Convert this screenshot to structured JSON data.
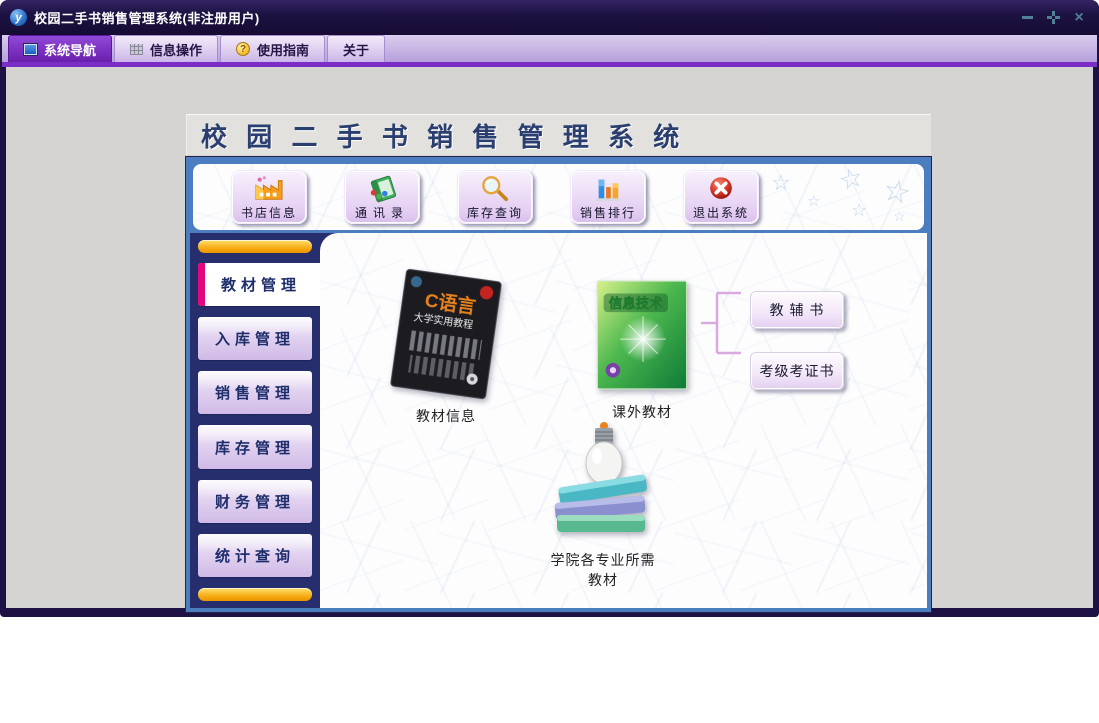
{
  "window": {
    "title": "校园二手书销售管理系统(非注册用户)",
    "app_icon_letter": "y",
    "controls": {
      "close_glyph": "×"
    }
  },
  "tabs": [
    {
      "label": "系统导航",
      "icon": "monitor-square-icon",
      "active": true
    },
    {
      "label": "信息操作",
      "icon": "grid-icon",
      "active": false
    },
    {
      "label": "使用指南",
      "icon": "help-coin-icon",
      "active": false,
      "icon_glyph": "?"
    },
    {
      "label": "关于",
      "active": false
    }
  ],
  "banner": {
    "title": "校 园 二 手 书 销 售 管 理 系 统"
  },
  "toolbar": {
    "buttons": [
      {
        "label": "书店信息",
        "icon": "factory-icon"
      },
      {
        "label": "通讯录",
        "icon": "address-book-icon"
      },
      {
        "label": "库存查询",
        "icon": "magnifier-icon"
      },
      {
        "label": "销售排行",
        "icon": "bar-chart-icon"
      },
      {
        "label": "退出系统",
        "icon": "exit-icon"
      }
    ],
    "star_glyph": "☆"
  },
  "sidebar": {
    "items": [
      {
        "label": "教材管理",
        "active": true
      },
      {
        "label": "入库管理",
        "active": false
      },
      {
        "label": "销售管理",
        "active": false
      },
      {
        "label": "库存管理",
        "active": false
      },
      {
        "label": "财务管理",
        "active": false
      },
      {
        "label": "统计查询",
        "active": false
      }
    ]
  },
  "content": {
    "textbook_item": {
      "label": "教材信息",
      "cover_title": "C语言",
      "cover_subtitle": "大学实用教程"
    },
    "extracurricular_item": {
      "label": "课外教材",
      "cover_title": "信息技术"
    },
    "category_buttons": [
      {
        "label": "教 辅 书"
      },
      {
        "label": "考级考证书"
      }
    ],
    "college_item": {
      "label": "学院各专业所需教材"
    }
  },
  "colors": {
    "accent_purple": "#7B2EC6",
    "magenta_strip": "#E4067E",
    "orange_bar": "#F5A50B",
    "panel_border_blue": "#4B7DBF",
    "frame_navy": "#1D1243"
  }
}
